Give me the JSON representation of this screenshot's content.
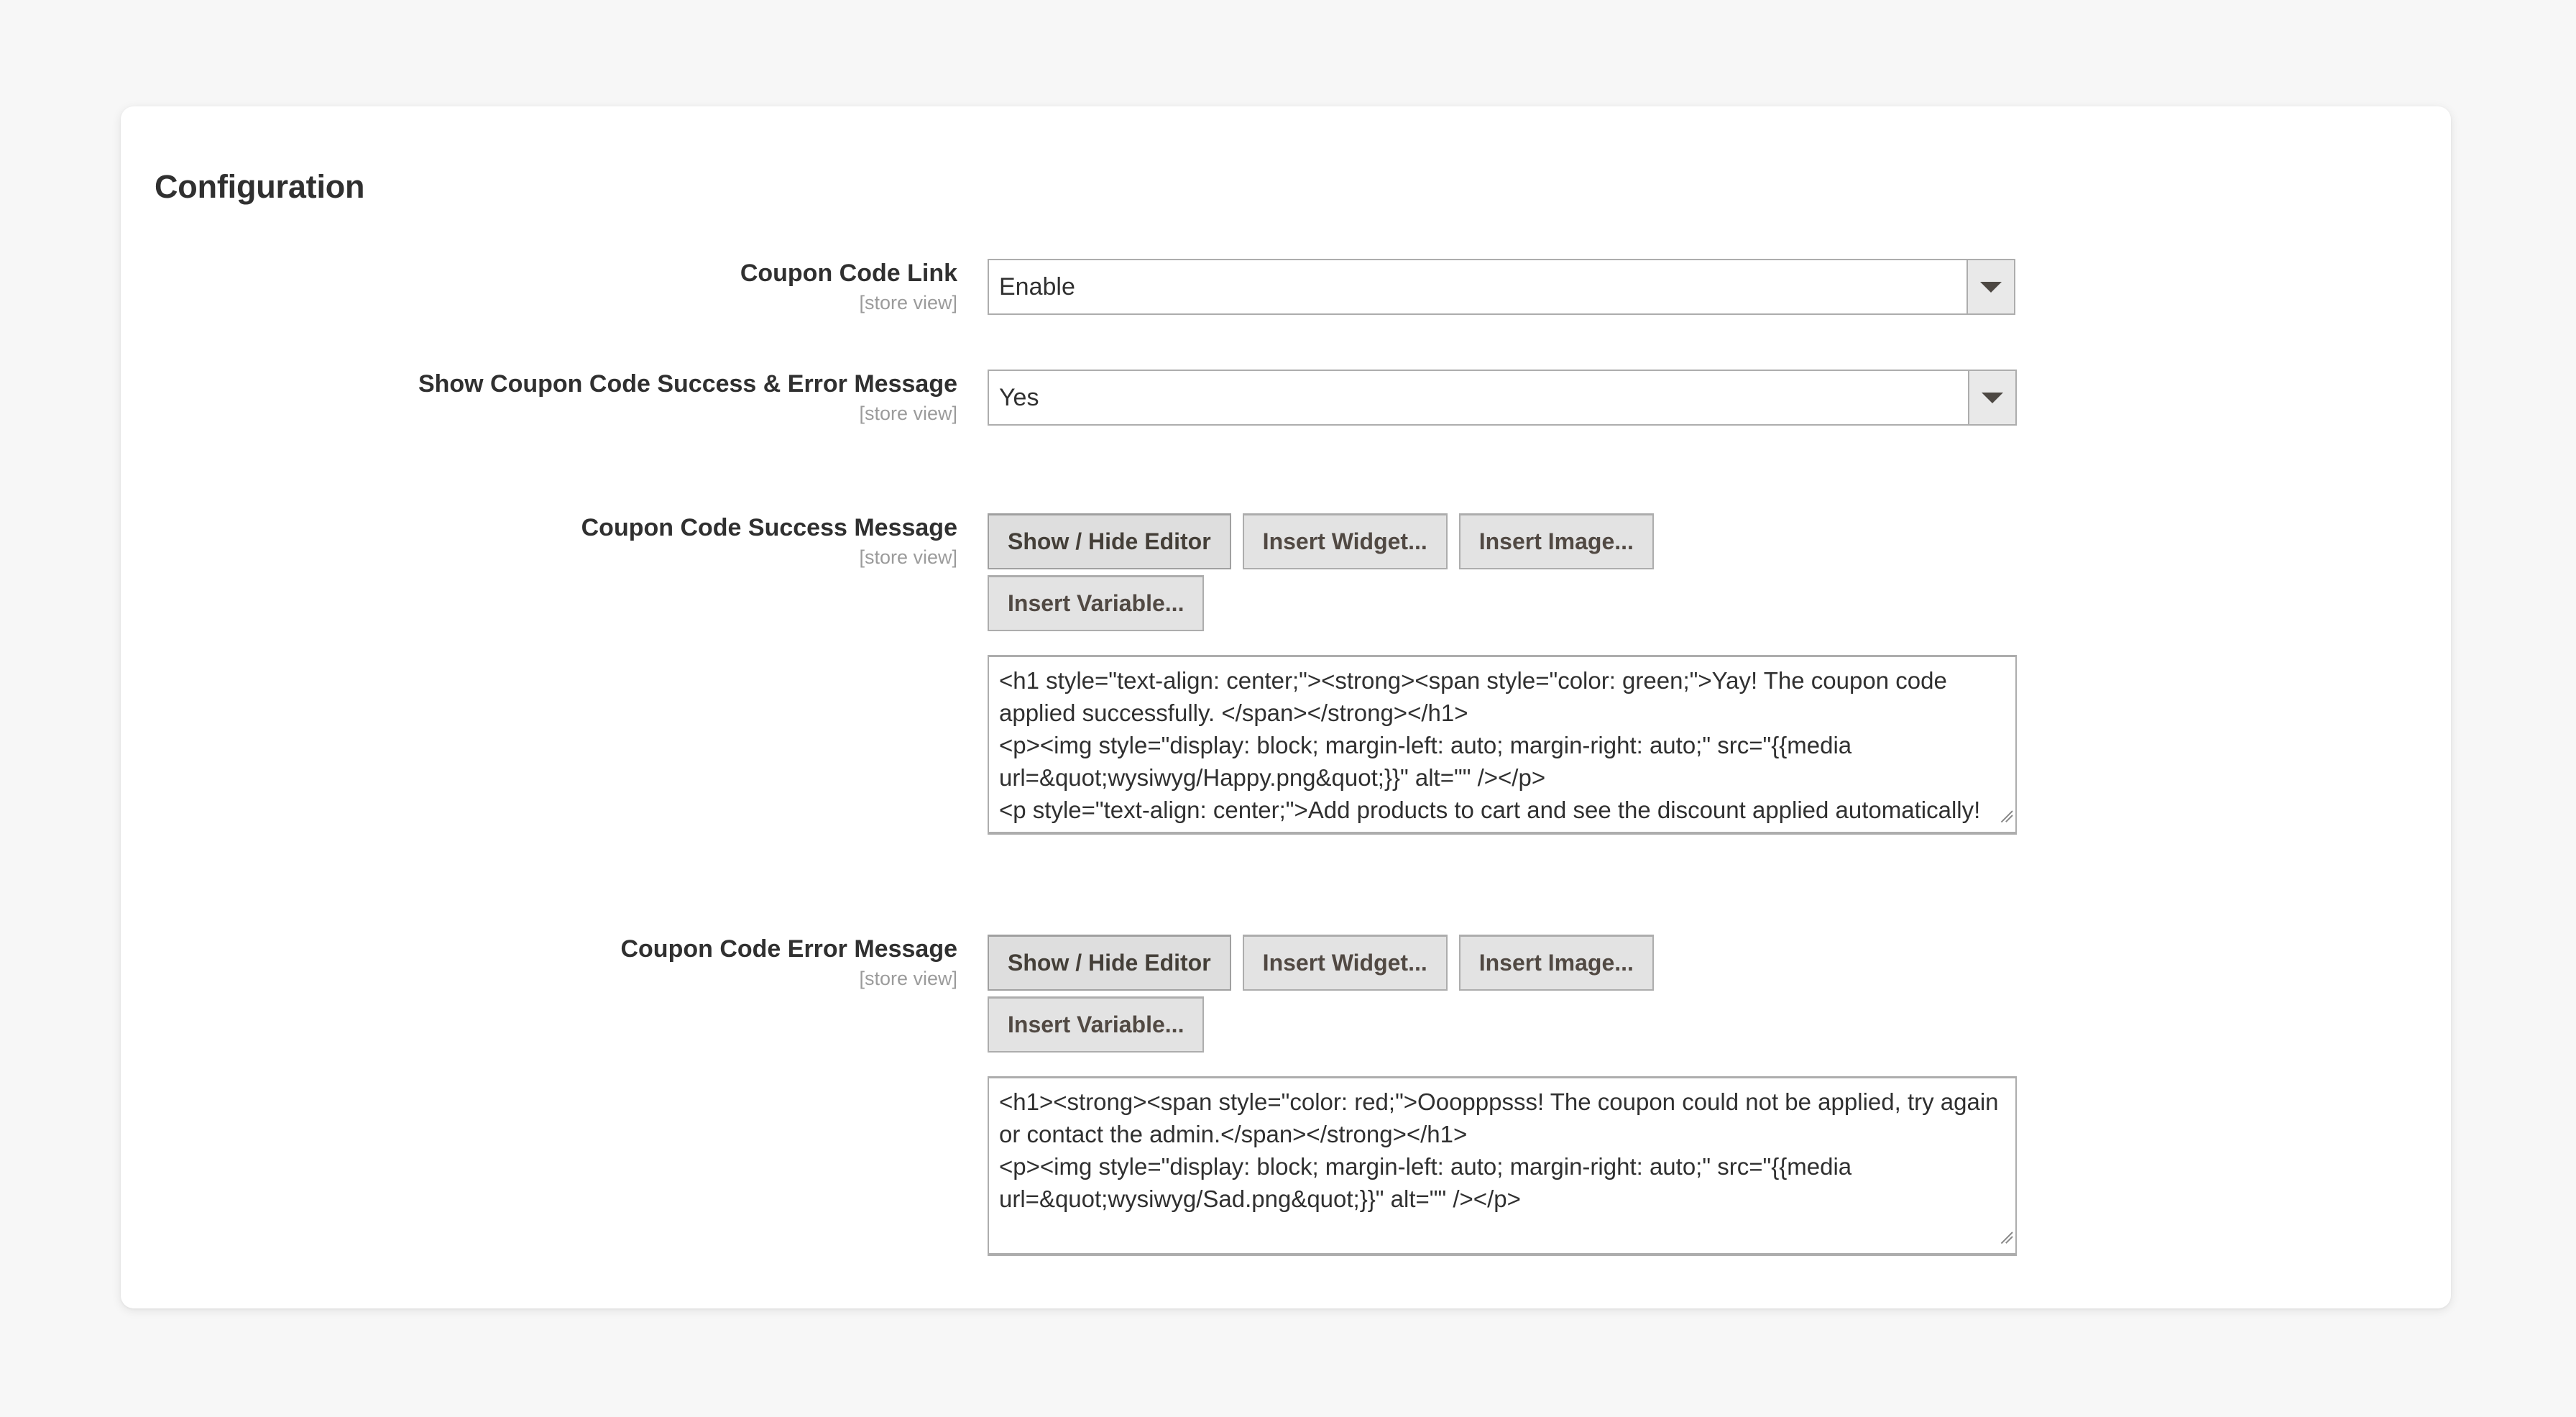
{
  "page": {
    "title": "Configuration",
    "background_color": "#f7f7f7",
    "card_color": "#ffffff"
  },
  "scope_label": "[store view]",
  "fields": [
    {
      "label": "Coupon Code Link",
      "scope": "[store view]",
      "type": "select",
      "value": "Enable"
    },
    {
      "label": "Show Coupon Code Success & Error Message",
      "scope": "[store view]",
      "type": "select",
      "value": "Yes"
    },
    {
      "label": "Coupon Code Success Message",
      "scope": "[store view]",
      "type": "wysiwyg",
      "buttons": [
        "Show / Hide Editor",
        "Insert Widget...",
        "Insert Image...",
        "Insert Variable..."
      ],
      "value": "<h1 style=\"text-align: center;\"><strong><span style=\"color: green;\">Yay! The coupon code applied successfully. </span></strong></h1>\n<p><img style=\"display: block; margin-left: auto; margin-right: auto;\" src=\"{{media url=&quot;wysiwyg/Happy.png&quot;}}\" alt=\"\" /></p>\n<p style=\"text-align: center;\">Add products to cart and see the discount applied automatically!</p>"
    },
    {
      "label": "Coupon Code Error Message",
      "scope": "[store view]",
      "type": "wysiwyg",
      "buttons": [
        "Show / Hide Editor",
        "Insert Widget...",
        "Insert Image...",
        "Insert Variable..."
      ],
      "value": "<h1><strong><span style=\"color: red;\">Ooopppsss! The coupon could not be applied, try again or contact the admin.</span></strong></h1>\n<p><img style=\"display: block; margin-left: auto; margin-right: auto;\" src=\"{{media url=&quot;wysiwyg/Sad.png&quot;}}\" alt=\"\" /></p>"
    }
  ],
  "icons": {
    "dropdown": "chevron-down-icon",
    "resize": "resize-grip-icon"
  }
}
